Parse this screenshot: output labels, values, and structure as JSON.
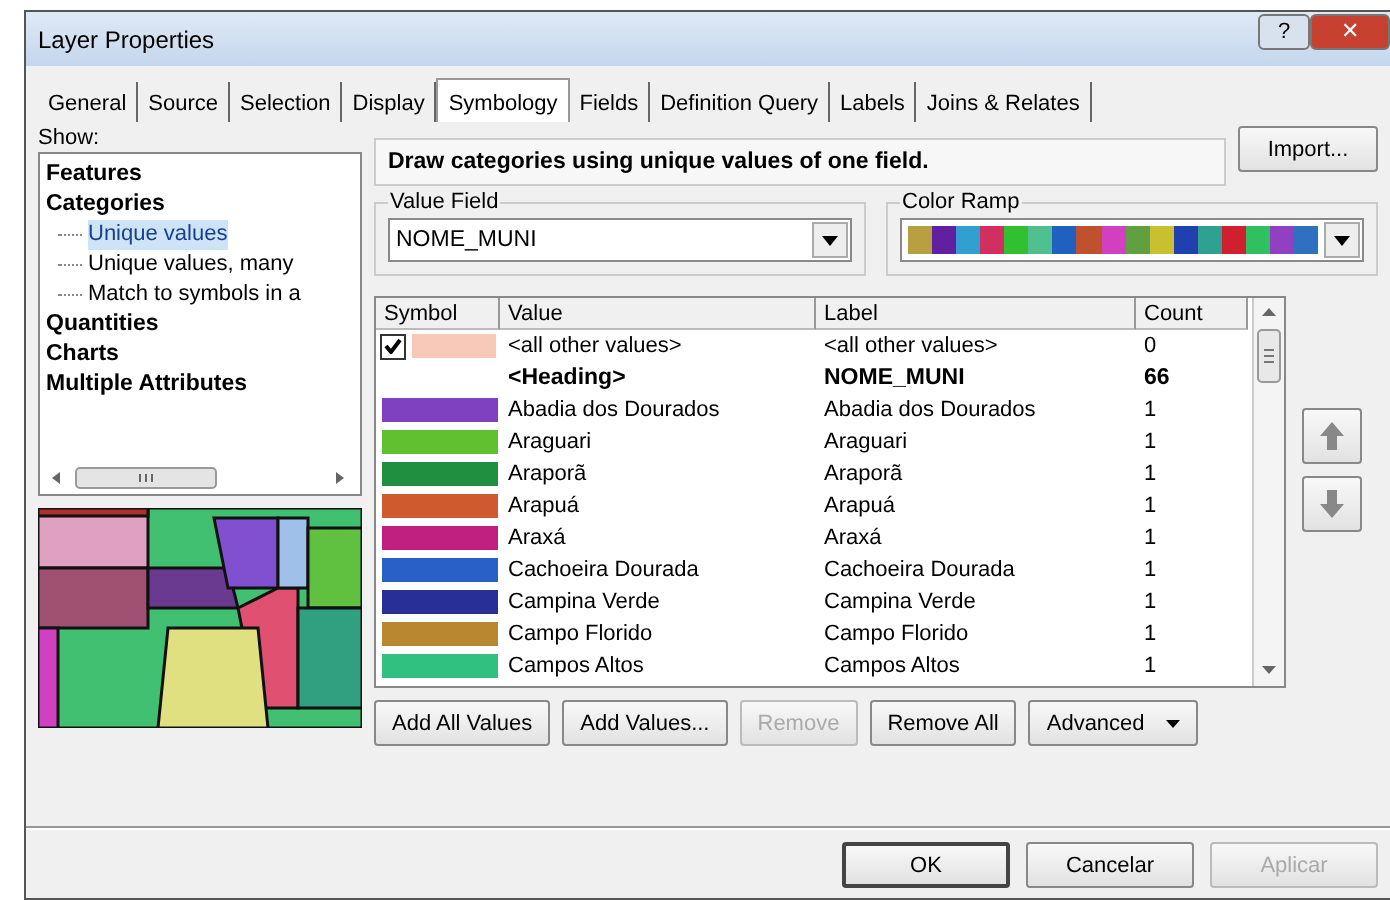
{
  "window": {
    "title": "Layer Properties",
    "help": "?",
    "close": "✕"
  },
  "tabs": [
    {
      "label": "General",
      "selected": false
    },
    {
      "label": "Source",
      "selected": false
    },
    {
      "label": "Selection",
      "selected": false
    },
    {
      "label": "Display",
      "selected": false
    },
    {
      "label": "Symbology",
      "selected": true
    },
    {
      "label": "Fields",
      "selected": false
    },
    {
      "label": "Definition Query",
      "selected": false
    },
    {
      "label": "Labels",
      "selected": false
    },
    {
      "label": "Joins & Relates",
      "selected": false
    }
  ],
  "show": {
    "label": "Show:",
    "items": [
      {
        "label": "Features",
        "selected": false
      },
      {
        "label": "Categories",
        "selected": false,
        "children": [
          {
            "label": "Unique values",
            "selected": true
          },
          {
            "label": "Unique values, many",
            "selected": false
          },
          {
            "label": "Match to symbols in a",
            "selected": false
          }
        ]
      },
      {
        "label": "Quantities",
        "selected": false
      },
      {
        "label": "Charts",
        "selected": false
      },
      {
        "label": "Multiple Attributes",
        "selected": false
      }
    ]
  },
  "description": "Draw categories using unique values of one field.",
  "import_button": "Import...",
  "value_field": {
    "label": "Value Field",
    "value": "NOME_MUNI"
  },
  "color_ramp": {
    "label": "Color Ramp"
  },
  "table": {
    "columns": [
      "Symbol",
      "Value",
      "Label",
      "Count"
    ],
    "rows": [
      {
        "kind": "other",
        "checked": true,
        "color": "#f8c8b8",
        "value": "<all other values>",
        "label": "<all other values>",
        "count": "0"
      },
      {
        "kind": "heading",
        "value": "<Heading>",
        "label": "NOME_MUNI",
        "count": "66"
      },
      {
        "kind": "value",
        "color": "#8040c0",
        "value": "Abadia dos Dourados",
        "label": "Abadia dos Dourados",
        "count": "1"
      },
      {
        "kind": "value",
        "color": "#60c030",
        "value": "Araguari",
        "label": "Araguari",
        "count": "1"
      },
      {
        "kind": "value",
        "color": "#209040",
        "value": "Araporã",
        "label": "Araporã",
        "count": "1"
      },
      {
        "kind": "value",
        "color": "#d05a30",
        "value": "Arapuá",
        "label": "Arapuá",
        "count": "1"
      },
      {
        "kind": "value",
        "color": "#c02080",
        "value": "Araxá",
        "label": "Araxá",
        "count": "1"
      },
      {
        "kind": "value",
        "color": "#2860c8",
        "value": "Cachoeira Dourada",
        "label": "Cachoeira Dourada",
        "count": "1"
      },
      {
        "kind": "value",
        "color": "#283098",
        "value": "Campina Verde",
        "label": "Campina Verde",
        "count": "1"
      },
      {
        "kind": "value",
        "color": "#b88830",
        "value": "Campo Florido",
        "label": "Campo Florido",
        "count": "1"
      },
      {
        "kind": "value",
        "color": "#30c080",
        "value": "Campos Altos",
        "label": "Campos Altos",
        "count": "1"
      }
    ]
  },
  "table_buttons": [
    {
      "label": "Add All Values",
      "disabled": false
    },
    {
      "label": "Add Values...",
      "disabled": false
    },
    {
      "label": "Remove",
      "disabled": true
    },
    {
      "label": "Remove All",
      "disabled": false
    },
    {
      "label": "Advanced",
      "disabled": false,
      "menu": true
    }
  ],
  "dialog_buttons": [
    {
      "label": "OK",
      "disabled": false,
      "default": true
    },
    {
      "label": "Cancelar",
      "disabled": false,
      "default": false
    },
    {
      "label": "Aplicar",
      "disabled": true,
      "default": false
    }
  ]
}
